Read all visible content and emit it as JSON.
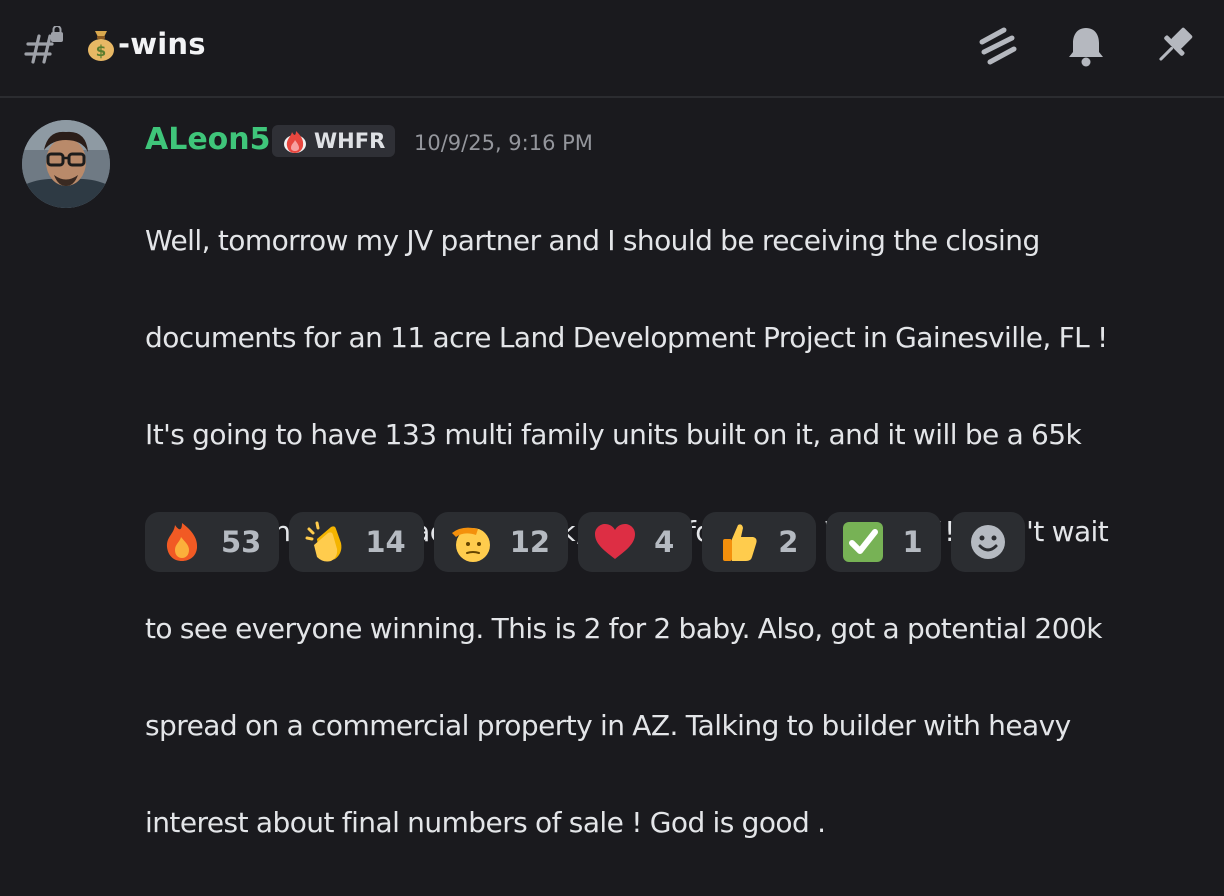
{
  "channel": {
    "name": "-wins",
    "emoji": "money-bag"
  },
  "header_icons": [
    "threads-icon",
    "bell-icon",
    "pin-icon"
  ],
  "message": {
    "author": "ALeon5",
    "author_color": "#3fc57a",
    "tag": {
      "icon": "fire",
      "label": "WHFR"
    },
    "timestamp": "10/9/25, 9:16 PM",
    "lines": [
      "Well, tomorrow my JV partner and I should be receiving the closing",
      "documents for an 11 acre Land Development Project in Gainesville, FL !",
      "It's going to have 133 multi family units built on it, and it will be a 65k",
      "spread. Under contract for 584k, selling for 649k ! Woohoo!!! Can't wait",
      "to see everyone winning. This is 2 for 2 baby. Also, got a potential 200k",
      "spread on a commercial property in AZ. Talking to builder with heavy",
      "interest about final numbers of sale ! God is good ."
    ]
  },
  "reactions": [
    {
      "emoji": "fire",
      "count": "53"
    },
    {
      "emoji": "clapping-hands",
      "count": "14"
    },
    {
      "emoji": "saluting-face",
      "count": "12"
    },
    {
      "emoji": "red-heart",
      "count": "4"
    },
    {
      "emoji": "thumbs-up",
      "count": "2"
    },
    {
      "emoji": "check-mark-button",
      "count": "1"
    }
  ],
  "add_reaction": {
    "icon": "smiley-add-reaction"
  }
}
